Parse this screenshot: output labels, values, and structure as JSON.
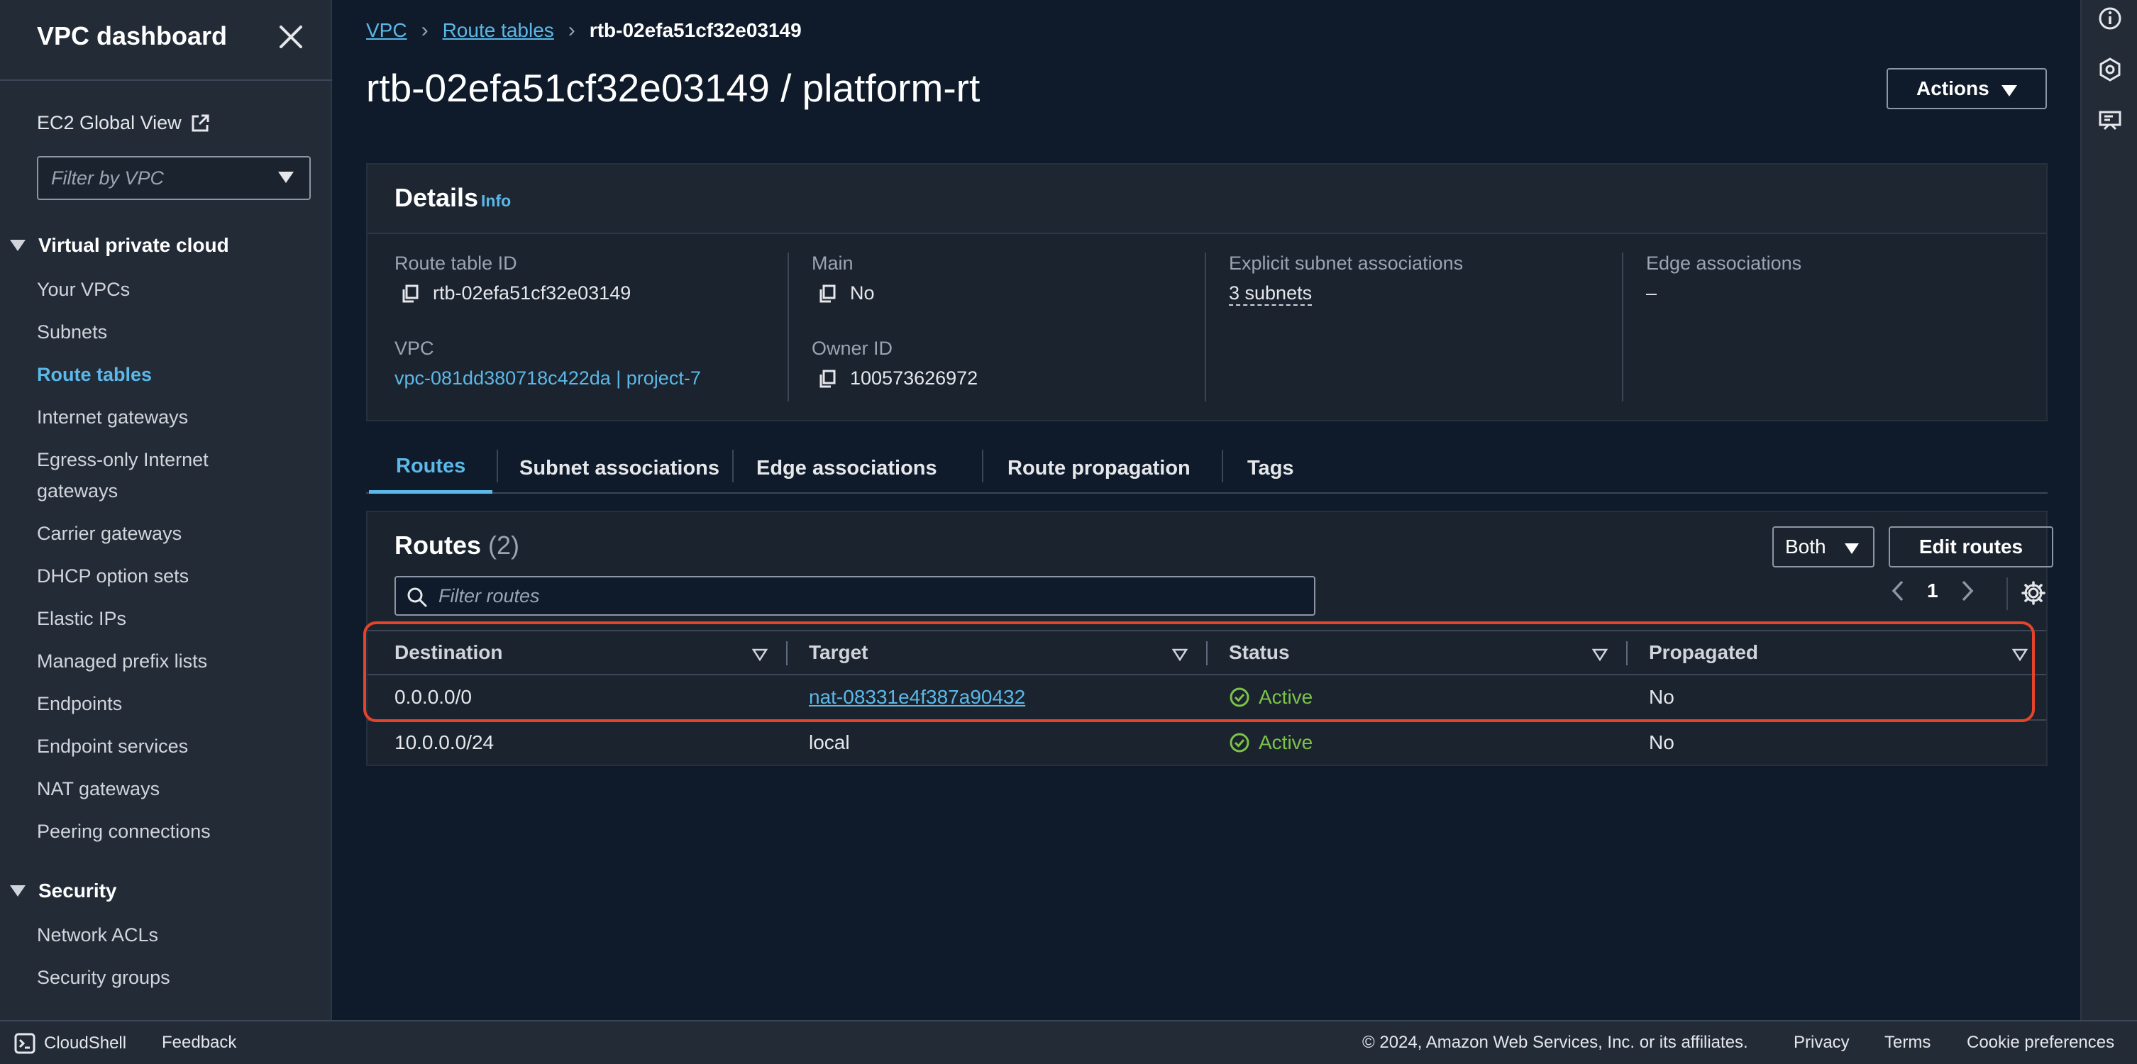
{
  "sidebar": {
    "title": "VPC dashboard",
    "global_view": "EC2 Global View",
    "filter_placeholder": "Filter by VPC",
    "sections": [
      {
        "title": "Virtual private cloud",
        "items": [
          "Your VPCs",
          "Subnets",
          "Route tables",
          "Internet gateways",
          "Egress-only Internet gateways",
          "Carrier gateways",
          "DHCP option sets",
          "Elastic IPs",
          "Managed prefix lists",
          "Endpoints",
          "Endpoint services",
          "NAT gateways",
          "Peering connections"
        ]
      },
      {
        "title": "Security",
        "items": [
          "Network ACLs",
          "Security groups"
        ]
      }
    ],
    "active_item": "Route tables"
  },
  "breadcrumb": {
    "vpc": "VPC",
    "route_tables": "Route tables",
    "current": "rtb-02efa51cf32e03149"
  },
  "page_title": "rtb-02efa51cf32e03149 / platform-rt",
  "actions_label": "Actions",
  "details": {
    "title": "Details",
    "info": "Info",
    "route_table_id_label": "Route table ID",
    "route_table_id": "rtb-02efa51cf32e03149",
    "vpc_label": "VPC",
    "vpc_value": "vpc-081dd380718c422da | project-7",
    "main_label": "Main",
    "main_value": "No",
    "owner_label": "Owner ID",
    "owner_value": "100573626972",
    "subnet_assoc_label": "Explicit subnet associations",
    "subnet_assoc_value": "3 subnets",
    "edge_assoc_label": "Edge associations",
    "edge_assoc_value": "–"
  },
  "tabs": [
    "Routes",
    "Subnet associations",
    "Edge associations",
    "Route propagation",
    "Tags"
  ],
  "routes": {
    "title": "Routes",
    "count": "(2)",
    "both_label": "Both",
    "edit_label": "Edit routes",
    "filter_placeholder": "Filter routes",
    "page": "1",
    "columns": [
      "Destination",
      "Target",
      "Status",
      "Propagated"
    ],
    "rows": [
      {
        "destination": "0.0.0.0/0",
        "target": "nat-08331e4f387a90432",
        "status": "Active",
        "propagated": "No"
      },
      {
        "destination": "10.0.0.0/24",
        "target": "local",
        "status": "Active",
        "propagated": "No"
      }
    ]
  },
  "footer": {
    "cloudshell": "CloudShell",
    "feedback": "Feedback",
    "copyright": "© 2024, Amazon Web Services, Inc. or its affiliates.",
    "privacy": "Privacy",
    "terms": "Terms",
    "cookies": "Cookie preferences"
  },
  "colors": {
    "accent": "#5bb8e8",
    "active_status": "#7bc34a",
    "highlight": "#e4442a",
    "background": "#0f1b2a",
    "panel": "#1b232e"
  }
}
